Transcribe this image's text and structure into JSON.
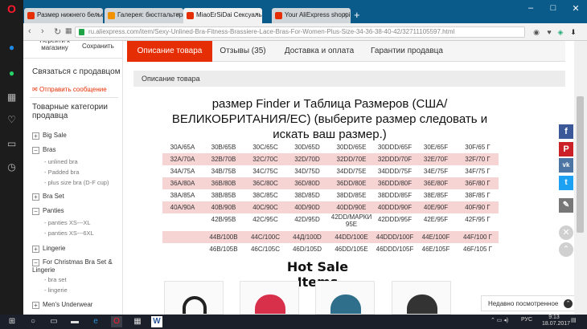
{
  "browser": {
    "tabs": [
      {
        "label": "Размер нижнего белье на",
        "color": "#e62e04",
        "active": false
      },
      {
        "label": "Галерея: бюстгальтеры д",
        "color": "#f29200",
        "active": false
      },
      {
        "label": "MiaoErSiDai Сексуальны",
        "color": "#e62e04",
        "active": true
      },
      {
        "label": "Your AliExpress shopping",
        "color": "#e62e04",
        "active": false
      }
    ],
    "new_tab": "+",
    "url": "ru.aliexpress.com/item/Sexy-Unlined-Bra-Fitness-Brassiere-Lace-Bras-For-Women-Plus-Size-34-36-38-40-42/32711105597.html"
  },
  "left_panel": {
    "goto_store": "Перейти к магазину",
    "save": "Сохранить",
    "contact_title": "Связаться с продавцом",
    "send_message": "Отправить сообщение",
    "categories_title": "Товарные категории продавца",
    "categories": [
      {
        "label": "Big Sale",
        "sign": "+"
      },
      {
        "label": "Bras",
        "sign": "−"
      },
      {
        "label": "Bra Set",
        "sign": "+"
      },
      {
        "label": "Panties",
        "sign": "−"
      },
      {
        "label": "Lingerie",
        "sign": "+"
      },
      {
        "label": "For Christmas Bra Set & Lingerie",
        "sign": "−"
      },
      {
        "label": "Men's Underwear",
        "sign": "+"
      }
    ],
    "subcategories": {
      "bras": [
        "unlined bra",
        "Padded bra",
        "plus size bra (D-F cup)"
      ],
      "panties": [
        "panties XS---XL",
        "panties XS---6XL"
      ],
      "christmas": [
        "bra set",
        "lingerie"
      ]
    }
  },
  "product_tabs": [
    {
      "label": "Описание товара",
      "active": true
    },
    {
      "label": "Отзывы (35)",
      "active": false
    },
    {
      "label": "Доставка и оплата",
      "active": false
    },
    {
      "label": "Гарантии продавца",
      "active": false
    }
  ],
  "description_header": "Описание товара",
  "size_title": "размер Finder и Таблица Размеров (США/ ВЕЛИКОБРИТАНИЯ/ЕС) (выберите размер следовать и искать ваш размер.)",
  "size_table": [
    [
      "30A/65A",
      "30B/65B",
      "30C/65C",
      "30D/65D",
      "30DD/65E",
      "30DDD/65F",
      "30E/65F",
      "30F/65 Г"
    ],
    [
      "32A/70A",
      "32B/70B",
      "32C/70C",
      "32D/70D",
      "32DD/70E",
      "32DDD/70F",
      "32E/70F",
      "32F/70 Г"
    ],
    [
      "34A/75A",
      "34B/75B",
      "34C/75C",
      "34D/75D",
      "34DD/75E",
      "34DDD/75F",
      "34E/75F",
      "34F/75 Г"
    ],
    [
      "36A/80A",
      "36B/80B",
      "36C/80C",
      "36D/80D",
      "36DD/80E",
      "36DDD/80F",
      "36E/80F",
      "36F/80 Г"
    ],
    [
      "38A/85A",
      "38B/85B",
      "38C/85C",
      "38D/85D",
      "38DD/85E",
      "38DDD/85F",
      "38E/85F",
      "38F/85 Г"
    ],
    [
      "40A/90A",
      "40B/90B",
      "40C/90C",
      "40D/90D",
      "40DD/90E",
      "40DDD/90F",
      "40E/90F",
      "40F/90 Г"
    ],
    [
      "",
      "42B/95B",
      "42C/95C",
      "42D/95D",
      "42DD/МАРКИ 95E",
      "42DDD/95F",
      "42E/95F",
      "42F/95 Г"
    ],
    [
      "",
      "44B/100B",
      "44C/100C",
      "44Д/100D",
      "44DD/100E",
      "44DDD/100F",
      "44E/100F",
      "44F/100 Г"
    ],
    [
      "",
      "46B/105B",
      "46C/105C",
      "46D/105D",
      "46DD/105E",
      "46DDD/105F",
      "46E/105F",
      "46F/105 Г"
    ]
  ],
  "hot_sale": "Hot Sale Items",
  "recently_viewed": "Недавно посмотренное",
  "taskbar": {
    "lang": "РУС",
    "time": "9:13",
    "date": "18.07.2017"
  },
  "share_colors": {
    "facebook": "#3b5998",
    "pinterest": "#cb2027",
    "vk": "#4c75a3",
    "twitter": "#1da1f2",
    "edit": "#777777"
  }
}
